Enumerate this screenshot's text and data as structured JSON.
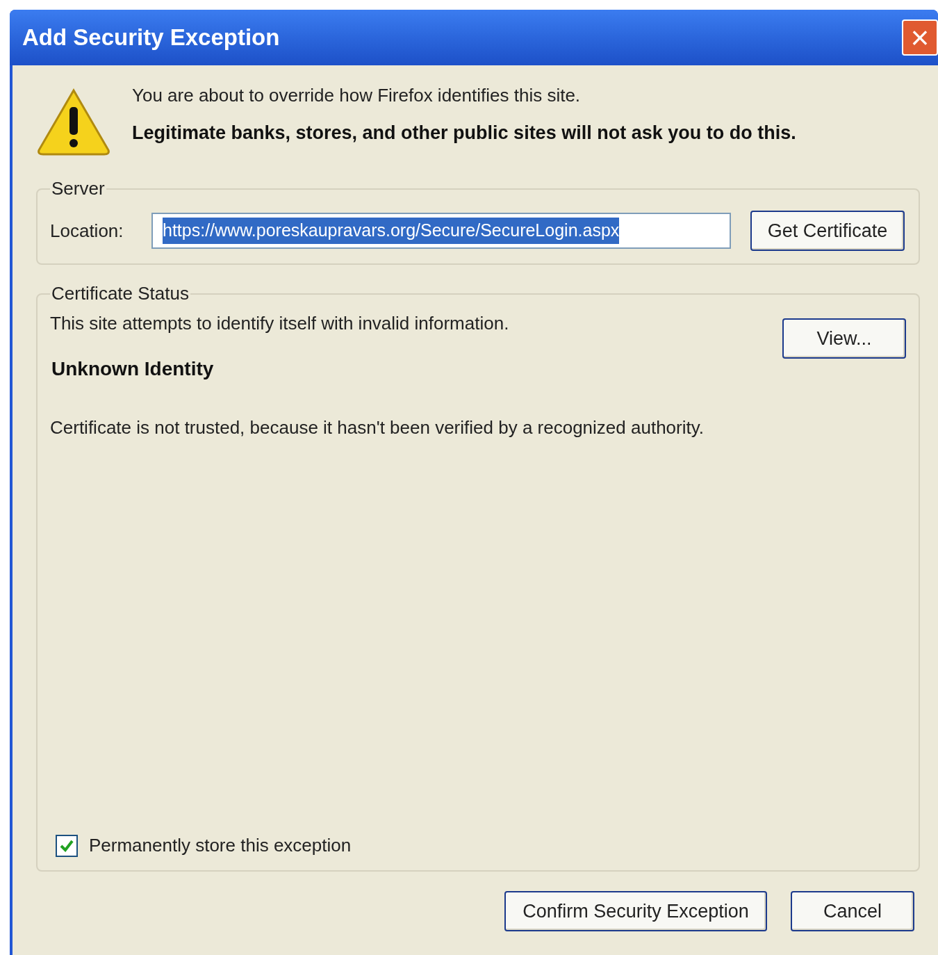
{
  "window": {
    "title": "Add Security Exception",
    "close_button": "×"
  },
  "warning": {
    "line": "You are about to override how Firefox identifies this site.",
    "emphasis": "Legitimate banks, stores, and other public sites will not ask you to do this."
  },
  "server": {
    "legend": "Server",
    "location_label": "Location:",
    "location_value": "https://www.poreskaupravars.org/Secure/SecureLogin.aspx",
    "text_selected": true,
    "button": "Get Certificate"
  },
  "certificate_status": {
    "legend": "Certificate Status",
    "summary": "This site attempts to identify itself with invalid information.",
    "view_button": "View...",
    "heading": "Unknown Identity",
    "detail": "Certificate is not trusted, because it hasn't been verified by a recognized authority."
  },
  "permanent": {
    "label": "Permanently store this exception",
    "checked": true
  },
  "buttons": [
    "Confirm Security Exception",
    "Cancel"
  ]
}
